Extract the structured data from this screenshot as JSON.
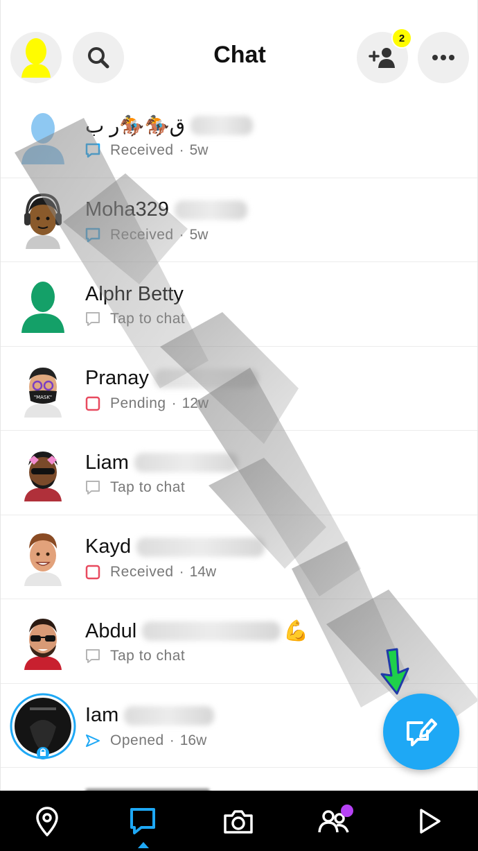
{
  "header": {
    "title": "Chat",
    "add_friend_badge": "2",
    "icons": [
      "bitmoji-profile-icon",
      "search-icon",
      "add-friend-icon",
      "more-options-icon"
    ]
  },
  "chats": [
    {
      "name": "ق🏇🏇ر ب",
      "status": "Received",
      "age": "5w",
      "status_kind": "received-chat"
    },
    {
      "name": "Moha329",
      "status": "Received",
      "age": "5w",
      "status_kind": "received-chat"
    },
    {
      "name": "Alphr Betty",
      "status": "Tap to chat",
      "age": "",
      "status_kind": "tap"
    },
    {
      "name": "Pranay",
      "status": "Pending",
      "age": "12w",
      "status_kind": "pending"
    },
    {
      "name": "Liam",
      "status": "Tap to chat",
      "age": "",
      "status_kind": "tap"
    },
    {
      "name": "Kayd",
      "status": "Received",
      "age": "14w",
      "status_kind": "received-snap"
    },
    {
      "name": "Abdul",
      "status": "Tap to chat",
      "age": "",
      "status_kind": "tap",
      "trailing_emoji": "💪"
    },
    {
      "name": "Iam",
      "status": "Opened",
      "age": "16w",
      "status_kind": "opened"
    }
  ],
  "separator": "·",
  "colors": {
    "accent_blue": "#1ea8f5",
    "snap_red": "#e84a5f",
    "snap_yellow": "#fffc00",
    "nav_dot_purple": "#b642f5"
  },
  "bottom_nav": [
    "map-icon",
    "chat-icon",
    "camera-icon",
    "stories-icon",
    "spotlight-icon"
  ]
}
